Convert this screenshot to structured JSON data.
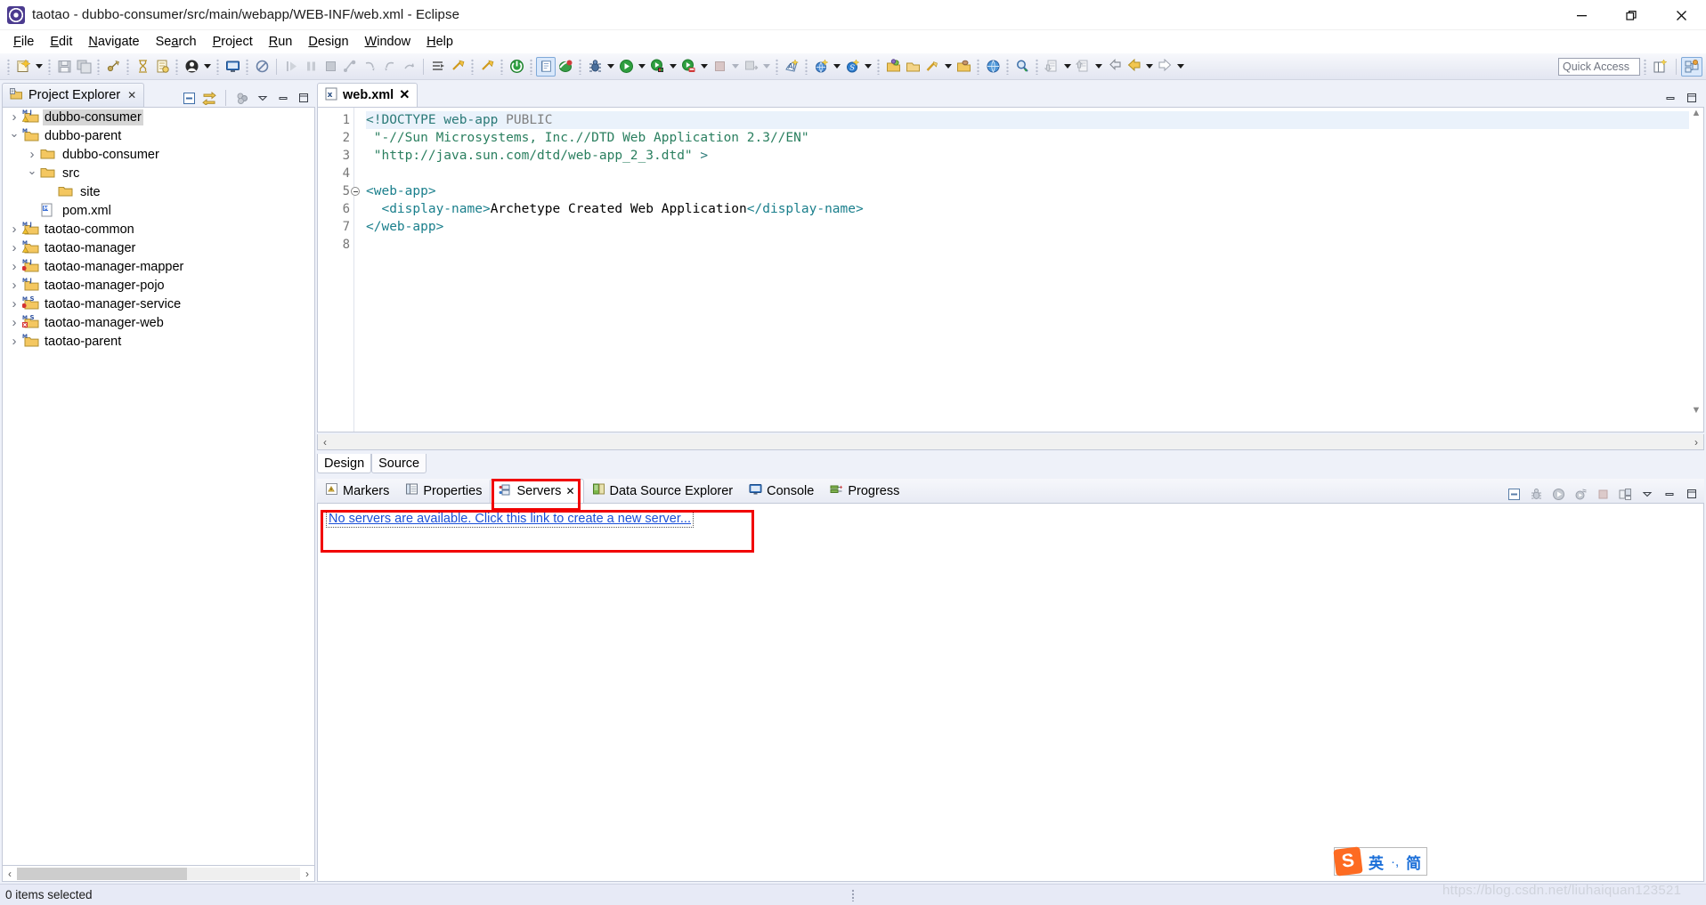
{
  "window": {
    "title": "taotao - dubbo-consumer/src/main/webapp/WEB-INF/web.xml - Eclipse",
    "app_icon": "eclipse-icon",
    "minimize": "—",
    "maximize": "❐",
    "close": "✕"
  },
  "menubar": [
    {
      "label": "File",
      "mnemonic": "F"
    },
    {
      "label": "Edit",
      "mnemonic": "E"
    },
    {
      "label": "Navigate",
      "mnemonic": "N"
    },
    {
      "label": "Search",
      "mnemonic": "a"
    },
    {
      "label": "Project",
      "mnemonic": "P"
    },
    {
      "label": "Run",
      "mnemonic": "R"
    },
    {
      "label": "Design",
      "mnemonic": "D"
    },
    {
      "label": "Window",
      "mnemonic": "W"
    },
    {
      "label": "Help",
      "mnemonic": "H"
    }
  ],
  "toolbar": {
    "quick_access_placeholder": "Quick Access",
    "items": [
      "new-wizard-icon",
      "save-icon",
      "save-all-icon",
      "link-icon",
      "validate-icon",
      "build-icon",
      "user-icon",
      "console-icon",
      "skip-breakpoints-icon",
      "step-over-icon",
      "pause-icon",
      "terminate-icon",
      "step-into-icon",
      "step-return-icon",
      "resume-icon",
      "drop-to-frame-icon",
      "run-last-tool-icon",
      "external-tools-icon",
      "terminal-icon",
      "spell-icon",
      "debug-icon",
      "run-icon",
      "run-as-icon",
      "coverage-icon",
      "stop-icon",
      "profile-icon",
      "new-java-class-icon",
      "new-web-project-icon",
      "new-spring-icon",
      "open-type-icon",
      "open-task-icon",
      "annotation-icon",
      "search-icon",
      "open-web-browser-icon",
      "pin-editor-icon",
      "next-annotation-icon",
      "previous-annotation-icon",
      "last-edit-location-icon",
      "back-icon",
      "forward-icon",
      "new-perspective-icon",
      "java-ee-perspective-icon"
    ]
  },
  "project_explorer": {
    "title": "Project Explorer",
    "close_label": "✕",
    "tools": [
      "collapse-all-icon",
      "link-with-editor-icon",
      "view-menu-icon",
      "minimize-icon",
      "maximize-icon"
    ],
    "tree": [
      {
        "label": "dubbo-consumer",
        "indent": 0,
        "twisty": "collapsed",
        "icon": "maven-java-project-warning-icon",
        "selected": true
      },
      {
        "label": "dubbo-parent",
        "indent": 0,
        "twisty": "expanded",
        "icon": "maven-project-icon",
        "selected": false
      },
      {
        "label": "dubbo-consumer",
        "indent": 1,
        "twisty": "collapsed",
        "icon": "folder-icon",
        "selected": false
      },
      {
        "label": "src",
        "indent": 1,
        "twisty": "expanded",
        "icon": "folder-icon",
        "selected": false
      },
      {
        "label": "site",
        "indent": 2,
        "twisty": "none",
        "icon": "folder-icon",
        "selected": false
      },
      {
        "label": "pom.xml",
        "indent": 1,
        "twisty": "none",
        "icon": "maven-pom-icon",
        "selected": false
      },
      {
        "label": "taotao-common",
        "indent": 0,
        "twisty": "collapsed",
        "icon": "maven-java-project-warning-icon",
        "selected": false
      },
      {
        "label": "taotao-manager",
        "indent": 0,
        "twisty": "collapsed",
        "icon": "maven-project-warning-icon",
        "selected": false
      },
      {
        "label": "taotao-manager-mapper",
        "indent": 0,
        "twisty": "collapsed",
        "icon": "maven-java-project-error-icon",
        "selected": false
      },
      {
        "label": "taotao-manager-pojo",
        "indent": 0,
        "twisty": "collapsed",
        "icon": "maven-java-project-icon",
        "selected": false
      },
      {
        "label": "taotao-manager-service",
        "indent": 0,
        "twisty": "collapsed",
        "icon": "maven-spring-project-error-icon",
        "selected": false
      },
      {
        "label": "taotao-manager-web",
        "indent": 0,
        "twisty": "collapsed",
        "icon": "maven-spring-project-xerror-icon",
        "selected": false
      },
      {
        "label": "taotao-parent",
        "indent": 0,
        "twisty": "collapsed",
        "icon": "maven-project-icon",
        "selected": false
      }
    ]
  },
  "editor": {
    "tab_label": "web.xml",
    "tab_icon": "xml-file-icon",
    "tab_close": "✕",
    "current_line": 1,
    "lines": [
      {
        "no": "1",
        "fold": false,
        "segments": [
          {
            "text": "<!DOCTYPE web-app ",
            "cls": "tok-dt"
          },
          {
            "text": "PUBLIC",
            "cls": "tok-kw"
          }
        ]
      },
      {
        "no": "2",
        "fold": false,
        "segments": [
          {
            "text": " \"-//Sun Microsystems, Inc.//DTD Web Application 2.3//EN\"",
            "cls": "tok-str"
          }
        ]
      },
      {
        "no": "3",
        "fold": false,
        "segments": [
          {
            "text": " \"http://java.sun.com/dtd/web-app_2_3.dtd\"",
            "cls": "tok-str"
          },
          {
            "text": " >",
            "cls": "tok-dt"
          }
        ]
      },
      {
        "no": "4",
        "fold": false,
        "segments": [
          {
            "text": "",
            "cls": "tok-txt"
          }
        ]
      },
      {
        "no": "5",
        "fold": true,
        "segments": [
          {
            "text": "<web-app>",
            "cls": "tok-tag"
          }
        ]
      },
      {
        "no": "6",
        "fold": false,
        "segments": [
          {
            "text": "  <display-name>",
            "cls": "tok-tag"
          },
          {
            "text": "Archetype Created Web Application",
            "cls": "tok-txt"
          },
          {
            "text": "</display-name>",
            "cls": "tok-tag"
          }
        ]
      },
      {
        "no": "7",
        "fold": false,
        "segments": [
          {
            "text": "</web-app>",
            "cls": "tok-tag"
          }
        ]
      },
      {
        "no": "8",
        "fold": false,
        "segments": [
          {
            "text": "",
            "cls": "tok-txt"
          }
        ]
      }
    ],
    "mode_tabs": [
      {
        "label": "Design",
        "active": true
      },
      {
        "label": "Source",
        "active": false
      }
    ],
    "scroll_left_arrow": "‹",
    "scroll_right_arrow": "›",
    "tools": [
      "minimize-icon",
      "maximize-icon"
    ]
  },
  "bottom_panel": {
    "tabs": [
      {
        "label": "Markers",
        "icon": "markers-icon",
        "active": false
      },
      {
        "label": "Properties",
        "icon": "properties-icon",
        "active": false
      },
      {
        "label": "Servers",
        "icon": "servers-icon",
        "active": true,
        "close": "✕"
      },
      {
        "label": "Data Source Explorer",
        "icon": "data-source-icon",
        "active": false
      },
      {
        "label": "Console",
        "icon": "console-icon",
        "active": false
      },
      {
        "label": "Progress",
        "icon": "progress-icon",
        "active": false
      }
    ],
    "tools": [
      "collapse-all-icon",
      "debug-server-icon",
      "start-server-icon",
      "start-profiling-icon",
      "stop-server-icon",
      "publish-icon",
      "view-menu-icon",
      "minimize-icon",
      "maximize-icon"
    ],
    "empty_message": "No servers are available. Click this link to create a new server..."
  },
  "statusbar": {
    "text": "0 items selected"
  },
  "ime": {
    "logo": "S",
    "mode": "英",
    "separator": "·,",
    "script": "简"
  },
  "watermark": {
    "text": "https://blog.csdn.net/liuhaiquan123521"
  },
  "annotations": {
    "servers_tab_highlight": "red-box",
    "servers_link_highlight": "red-box",
    "color": "#f10000"
  }
}
